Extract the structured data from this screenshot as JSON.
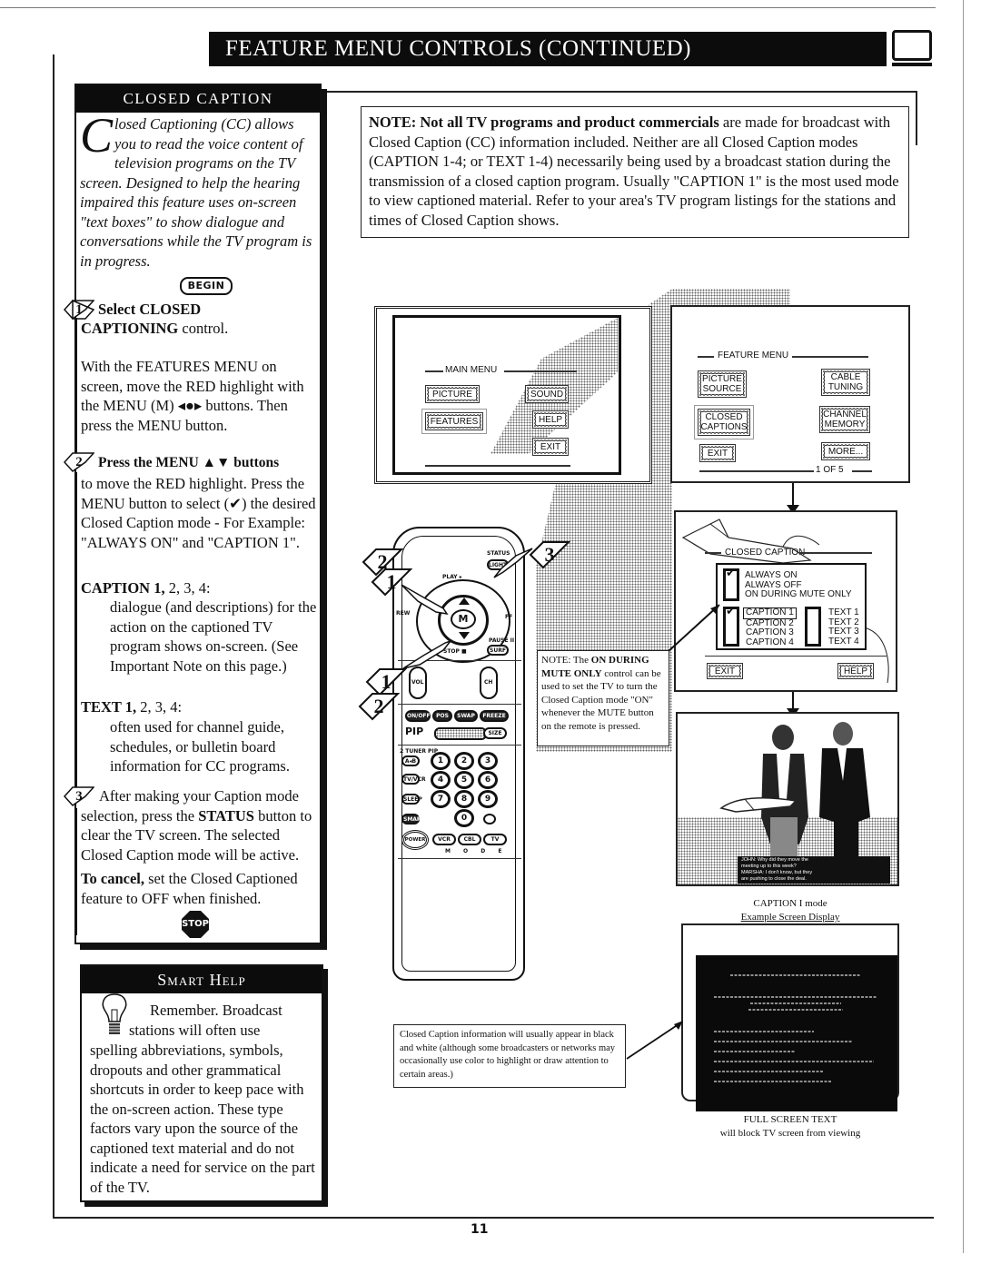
{
  "header": {
    "title": "Feature Menu Controls (continued)",
    "icon": "tv-icon"
  },
  "closed_caption_panel": {
    "heading": "CLOSED CAPTION",
    "intro_dropcap": "C",
    "intro_text": "losed Captioning (CC) allows you to read the voice content of television programs on the TV screen. Designed to help the hearing impaired this feature uses on-screen \"text boxes\" to show dialogue and conversations while the TV program is in progress.",
    "begin_badge": "BEGIN",
    "steps": [
      {
        "number": "1",
        "heading_bold": "Select CLOSED",
        "heading_line2_bold": "CAPTIONING",
        "heading_line2_rest": " control.",
        "body": "With the FEATURES MENU on screen, move the RED highlight with the MENU (M) ◂●▸ buttons. Then press the MENU button."
      },
      {
        "number": "2",
        "heading_bold": "Press the MENU ▲▼ buttons",
        "body": "to move the RED highlight. Press the MENU button to select (✔) the desired Closed Caption mode - For Example: \"ALWAYS ON\" and \"CAPTION 1\"."
      },
      {
        "number": "3",
        "body_pre": " After making your Caption mode selection, press the ",
        "body_bold": "STATUS",
        "body_post": " button to clear the TV screen. The selected Closed Caption mode will be active."
      }
    ],
    "caption_modes": {
      "label_bold": "CAPTION 1,",
      "label_rest": " 2, 3, 4:",
      "description": "dialogue (and descriptions) for the action on the captioned TV program shows on-screen. (See Important Note on this page.)"
    },
    "text_modes": {
      "label_bold": "TEXT 1,",
      "label_rest": " 2, 3, 4:",
      "description": "often used for channel guide, schedules, or bulletin board information for CC programs."
    },
    "cancel_bold": "To cancel,",
    "cancel_rest": " set the Closed Captioned feature to OFF when finished.",
    "stop_sign": "STOP"
  },
  "smart_help": {
    "heading": "Smart Help",
    "text_line1": "Remember.  Broadcast",
    "text_line2": "stations will often use",
    "text_rest": "spelling abbreviations, symbols, dropouts and other grammatical shortcuts in order to keep pace with the on-screen action. These type factors vary upon the source of the captioned text material and do not indicate a need for service on the part of the TV."
  },
  "note": {
    "bold": "NOTE: Not all TV programs and product commercials",
    "rest": " are made for broadcast with Closed Caption (CC) information included. Neither are all Closed Caption modes (CAPTION 1-4; or TEXT 1-4) necessarily being used by a broadcast station during the transmission of a closed caption program. Usually \"CAPTION 1\" is the most used mode to view captioned material. Refer to your area's TV program listings for the stations and times of Closed Caption shows."
  },
  "main_menu_screen": {
    "title": "MAIN MENU",
    "buttons": [
      "PICTURE",
      "SOUND",
      "FEATURES",
      "HELP",
      "EXIT"
    ],
    "highlighted": "FEATURES"
  },
  "feature_menu_screen": {
    "title": "FEATURE MENU",
    "buttons": [
      "PICTURE SOURCE",
      "CABLE TUNING",
      "CLOSED CAPTIONS",
      "CHANNEL MEMORY",
      "EXIT",
      "MORE..."
    ],
    "highlighted": "CLOSED CAPTIONS",
    "page_indicator": "1 OF 5"
  },
  "closed_caption_screen": {
    "title": "CLOSED CAPTION",
    "display_options": [
      "ALWAYS ON",
      "ALWAYS OFF",
      "ON DURING MUTE ONLY"
    ],
    "display_selected": "ALWAYS ON",
    "caption_options": [
      "CAPTION 1",
      "CAPTION 2",
      "CAPTION 3",
      "CAPTION 4"
    ],
    "caption_selected": "CAPTION 1",
    "text_options": [
      "TEXT 1",
      "TEXT 2",
      "TEXT 3",
      "TEXT 4"
    ],
    "exit_label": "EXIT",
    "help_label": "HELP"
  },
  "mute_note": {
    "prefix": "NOTE: The ",
    "bold": "ON DURING MUTE ONLY",
    "rest": " control can be used to set the TV to turn the Closed Caption mode \"ON\" whenever the MUTE button on the remote is pressed."
  },
  "remote": {
    "top_labels": {
      "play": "PLAY ▸",
      "status": "STATUS",
      "light": "LIGHT",
      "rew": "REW",
      "ff": "FF",
      "pause": "PAUSE II",
      "surf": "SURF",
      "stop": "STOP ■",
      "menu": "M",
      "vol": "VOL",
      "ch": "CH"
    },
    "pip_row": [
      "ON/OFF",
      "POS",
      "SWAP",
      "FREEZE"
    ],
    "pip_label": "PIP",
    "size_label": "SIZE",
    "tuner_label": "2 TUNER PIP",
    "side_buttons": [
      "A◂B",
      "TV/VCR",
      "SLEEP",
      "SMART"
    ],
    "digits": [
      "1",
      "2",
      "3",
      "4",
      "5",
      "6",
      "7",
      "8",
      "9",
      "0"
    ],
    "power_label": "POWER",
    "mode_buttons": [
      "VCR",
      "CBL",
      "TV"
    ],
    "mode_label": "M O D E",
    "callouts_left": [
      "2",
      "1",
      "1",
      "2"
    ],
    "callout_right": "3"
  },
  "caption_example": {
    "caption_lines": [
      "JOHN: Why did they move the",
      "meeting up to this week?",
      "MARSHA: I don't know, but they",
      "are pushing to close the deal."
    ],
    "label_line1": "CAPTION I mode",
    "label_line2": "Example Screen Display"
  },
  "full_screen_text": {
    "label_line1": "FULL SCREEN TEXT",
    "label_line2": "will block TV screen from viewing"
  },
  "caption_color_note": "Closed Caption information will usually appear in black and white (although some broadcasters or networks may occasionally use color to highlight or draw attention to certain areas.)",
  "page_number": "11"
}
